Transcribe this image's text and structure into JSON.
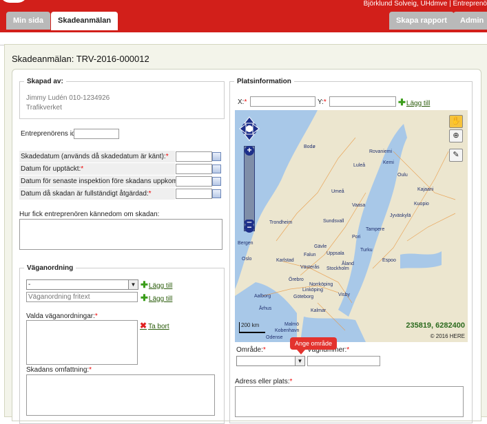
{
  "header": {
    "user_info": "Björklund Solveig, UHdmve | Entreprenö",
    "tabs": {
      "min_sida": "Min sida",
      "skadeanmalan": "Skadeanmälan",
      "skapa_rapport": "Skapa rapport",
      "admin": "Admin"
    }
  },
  "page": {
    "title": "Skadeanmälan: TRV-2016-000012"
  },
  "created_by": {
    "legend": "Skapad av:",
    "name_phone": "Jimmy Ludén 010-1234926",
    "organization": "Trafikverket"
  },
  "form": {
    "contractor_id_label": "Entreprenörens id:",
    "contractor_id_value": "",
    "damage_date_label": "Skadedatum (används då skadedatum är känt):",
    "discovery_date_label": "Datum för upptäckt:",
    "last_inspection_label": "Datum för senaste inspektion före skadans uppkomst:",
    "fixed_date_label": "Datum då skadan är fullständigt åtgärdad:",
    "awareness_label": "Hur fick entreprenören kännedom om skadan:",
    "awareness_value": ""
  },
  "road_arrangement": {
    "legend": "Väganordning",
    "select_value": "-",
    "add_label": "Lägg till",
    "freetext_placeholder": "Väganordning fritext",
    "add_label_2": "Lägg till",
    "selected_label": "Valda väganordningar:",
    "remove_label": "Ta bort",
    "extent_label": "Skadans omfattning:"
  },
  "location": {
    "legend": "Platsinformation",
    "x_label": "X:",
    "y_label": "Y:",
    "x_value": "",
    "y_value": "",
    "add_label": "Lägg till",
    "map_coords": "235819, 6282400",
    "map_copyright": "© 2016 HERE",
    "map_scale": "200 km",
    "area_label": "Område:",
    "area_value": "",
    "tooltip": "Ange område",
    "road_number_label": "Vägnummer:",
    "road_number_value": "",
    "address_label": "Adress eller plats:",
    "map_places": [
      "Bodø",
      "Rovaniemi",
      "Kemi",
      "Luleå",
      "Oulu",
      "Kajaani",
      "Jyväskylä",
      "Kuopio",
      "Tampere",
      "Trondheim",
      "Sundsvall",
      "Umeå",
      "Vaasa",
      "Pori",
      "Åland",
      "Turku",
      "Espoo",
      "Uppsala",
      "Stockholm",
      "Västerås",
      "Örebro",
      "Göteborg",
      "Aalborg",
      "Århus",
      "Norrköping",
      "Linköping",
      "Karlstad",
      "Oslo",
      "Bergen",
      "Kalmar",
      "Malmö",
      "Odense",
      "Kobenhavn",
      "Visby",
      "Falun",
      "Gävle"
    ]
  },
  "colors": {
    "brand_red": "#d21f1a",
    "required_star": "#e00000",
    "tab_inactive": "#b9b9b9",
    "link_green": "#2a5b0a"
  }
}
